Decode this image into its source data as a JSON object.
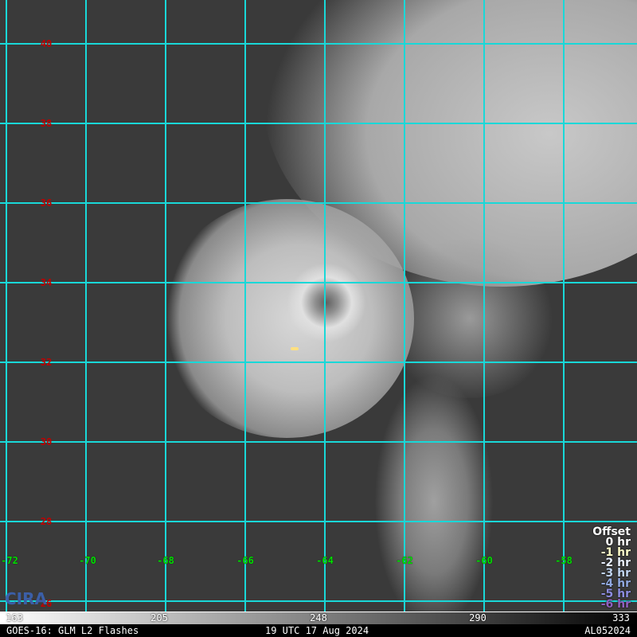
{
  "map": {
    "lat_labels": [
      "40",
      "38",
      "36",
      "34",
      "32",
      "30",
      "28",
      "26"
    ],
    "lon_labels": [
      "-72",
      "-70",
      "-68",
      "-66",
      "-64",
      "-62",
      "-60",
      "-58"
    ]
  },
  "legend": {
    "title": "Offset",
    "items": [
      {
        "label": "0 hr",
        "color": "#ffffff"
      },
      {
        "label": "-1 hr",
        "color": "#ffffc8"
      },
      {
        "label": "-2 hr",
        "color": "#e8f0ff"
      },
      {
        "label": "-3 hr",
        "color": "#c0d4f0"
      },
      {
        "label": "-4 hr",
        "color": "#90a8e0"
      },
      {
        "label": "-5 hr",
        "color": "#8c8ce0"
      },
      {
        "label": "-6 hr",
        "color": "#9060c0"
      }
    ]
  },
  "colorbar": {
    "ticks": [
      "163",
      "205",
      "248",
      "290",
      "333"
    ]
  },
  "footer": {
    "left": "GOES-16: GLM L2 Flashes",
    "center": "19 UTC 17 Aug 2024",
    "right": "AL052024"
  },
  "logo": {
    "text": "CIRA"
  }
}
